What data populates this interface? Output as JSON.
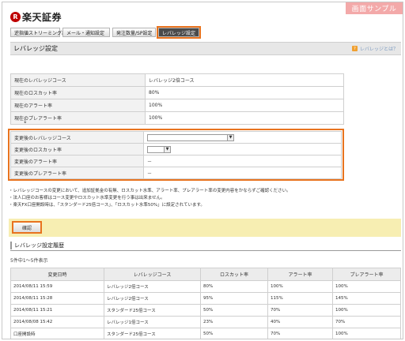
{
  "brand": {
    "mark": "R",
    "name": "楽天証券"
  },
  "sample_label": "画面サンプル",
  "tabs": [
    {
      "label": "逆指値ストリーミング設定"
    },
    {
      "label": "メール・通知設定"
    },
    {
      "label": "発注数量/SP設定"
    },
    {
      "label": "レバレッジ設定"
    }
  ],
  "header": {
    "title": "レバレッジ設定",
    "help": "レバレッジとは？"
  },
  "current": [
    {
      "label": "現在のレバレッジコース",
      "value": "レバレッジ2倍コース"
    },
    {
      "label": "現在のロスカット率",
      "value": "80%"
    },
    {
      "label": "現在のアラート率",
      "value": "100%"
    },
    {
      "label": "現在のプレアラート率",
      "value": "100%"
    }
  ],
  "arrow": "↓",
  "change": [
    {
      "label": "変更後のレバレッジコース",
      "value": ""
    },
    {
      "label": "変更後のロスカット率",
      "value": ""
    },
    {
      "label": "変更後のアラート率",
      "value": "－"
    },
    {
      "label": "変更後のプレアラート率",
      "value": "－"
    }
  ],
  "notes": [
    "・レバレッジコースの変更において、追加証拠金の有無、ロスカット水準、アラート率、プレアラート率の変更内容をかならずご確認ください。",
    "・法人口座のお客様はコース変更やロスカット水準変更を行う事は出来ません。",
    "・楽天FX口座開設時は、「スタンダード25倍コース」、「ロスカット水準50%」に設定されています。"
  ],
  "confirm_label": "確認",
  "history": {
    "title": "レバレッジ設定履歴",
    "count": "5件中1〜5件表示",
    "columns": [
      "変更日時",
      "レバレッジコース",
      "ロスカット率",
      "アラート率",
      "プレアラート率"
    ],
    "rows": [
      [
        "2014/08/11 15:59",
        "レバレッジ2倍コース",
        "80%",
        "100%",
        "100%"
      ],
      [
        "2014/08/11 15:28",
        "レバレッジ2倍コース",
        "95%",
        "115%",
        "145%"
      ],
      [
        "2014/08/11 15:21",
        "スタンダード25倍コース",
        "50%",
        "70%",
        "100%"
      ],
      [
        "2014/08/08 15:42",
        "レバレッジ1倍コース",
        "23%",
        "40%",
        "70%"
      ],
      [
        "口座開設時",
        "スタンダード25倍コース",
        "50%",
        "70%",
        "100%"
      ]
    ]
  }
}
